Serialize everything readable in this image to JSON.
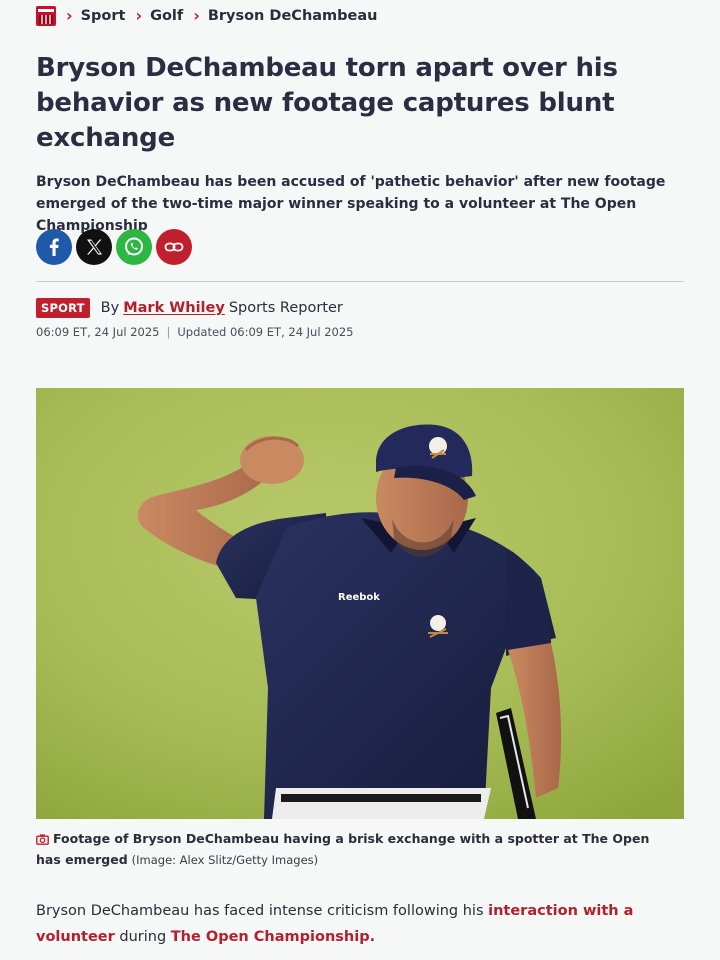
{
  "breadcrumb": {
    "logo": "publication-logo",
    "items": [
      "Sport",
      "Golf",
      "Bryson DeChambeau"
    ]
  },
  "article": {
    "headline": "Bryson DeChambeau torn apart over his behavior as new footage captures blunt exchange",
    "standfirst": "Bryson DeChambeau has been accused of 'pathetic behavior' after new footage emerged of the two-time major winner speaking to a volunteer at The Open Championship",
    "share_icons": [
      "facebook-icon",
      "x-icon",
      "whatsapp-icon",
      "link-icon"
    ],
    "category_badge": "SPORT",
    "by_label": "By",
    "author": "Mark Whiley",
    "author_role": "Sports Reporter",
    "published": "06:09 ET, 24 Jul 2025",
    "updated": "Updated 06:09 ET, 24 Jul 2025",
    "image_caption": "Footage of Bryson DeChambeau having a brisk exchange with a spotter at The Open has emerged",
    "image_credit": "(Image: Alex Slitz/Getty Images)",
    "body": {
      "text1": "Bryson DeChambeau has faced intense criticism following his ",
      "link1": "interaction with a volunteer",
      "text2": " during ",
      "link2": "The Open Championship."
    }
  },
  "colors": {
    "accent": "#c0202e",
    "text": "#2b2e42",
    "background": "#f6f7f7"
  }
}
